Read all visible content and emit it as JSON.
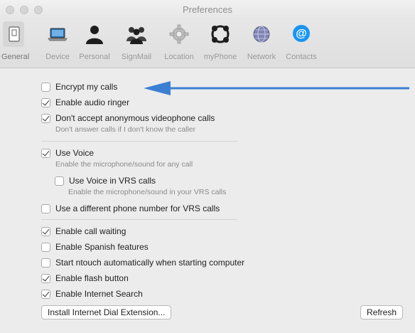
{
  "window": {
    "title": "Preferences"
  },
  "toolbar": {
    "items": [
      {
        "label": "General",
        "icon": "general-switch-icon",
        "selected": true
      },
      {
        "label": "Device",
        "icon": "laptop-icon"
      },
      {
        "label": "Personal",
        "icon": "person-icon"
      },
      {
        "label": "SignMail",
        "icon": "people-group-icon"
      },
      {
        "label": "Location",
        "icon": "gear-icon"
      },
      {
        "label": "myPhone",
        "icon": "connection-icon"
      },
      {
        "label": "Network",
        "icon": "globe-network-icon"
      },
      {
        "label": "Contacts",
        "icon": "at-sign-icon"
      }
    ]
  },
  "options": {
    "encrypt": {
      "label": "Encrypt my calls",
      "checked": false
    },
    "audio_ringer": {
      "label": "Enable audio ringer",
      "checked": true
    },
    "anonymous": {
      "label": "Don't accept anonymous videophone calls",
      "checked": true,
      "sub": "Don't answer calls if I don't know the caller"
    },
    "use_voice": {
      "label": "Use Voice",
      "checked": true,
      "sub": "Enable the microphone/sound for any call"
    },
    "voice_vrs": {
      "label": "Use Voice in VRS calls",
      "checked": false,
      "sub": "Enable the microphone/sound in your VRS calls"
    },
    "diff_number": {
      "label": "Use a different phone number for VRS calls",
      "checked": false
    },
    "call_waiting": {
      "label": "Enable call waiting",
      "checked": true
    },
    "spanish": {
      "label": "Enable Spanish features",
      "checked": false
    },
    "auto_start": {
      "label": "Start ntouch automatically when starting computer",
      "checked": false
    },
    "flash": {
      "label": "Enable flash button",
      "checked": true
    },
    "internet_search": {
      "label": "Enable Internet Search",
      "checked": true
    }
  },
  "buttons": {
    "install": "Install Internet Dial Extension...",
    "refresh": "Refresh"
  },
  "colors": {
    "arrow": "#3b7fd4",
    "at_icon": "#1a95f2"
  }
}
